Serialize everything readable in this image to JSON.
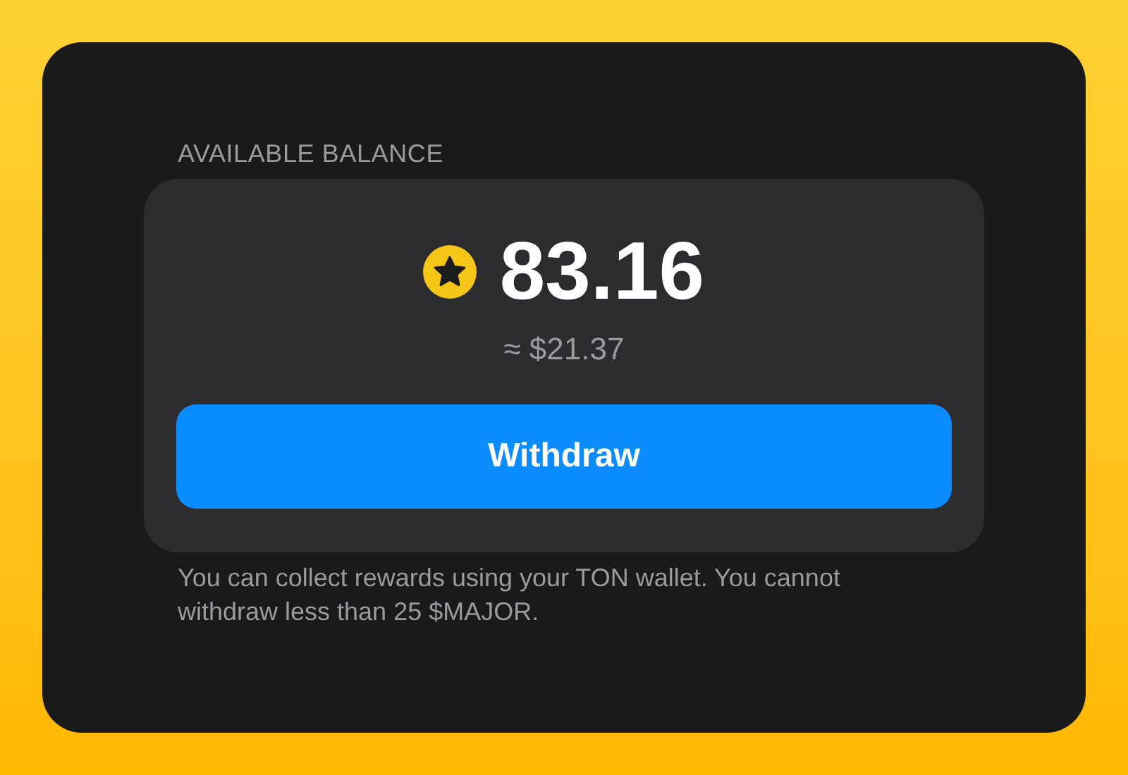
{
  "balance_label": "AVAILABLE BALANCE",
  "balance": {
    "amount": "83.16",
    "fiat": "≈ $21.37"
  },
  "withdraw_button": {
    "label": "Withdraw"
  },
  "note": "You can collect rewards using your TON wallet. You cannot withdraw less than 25 $MAJOR."
}
